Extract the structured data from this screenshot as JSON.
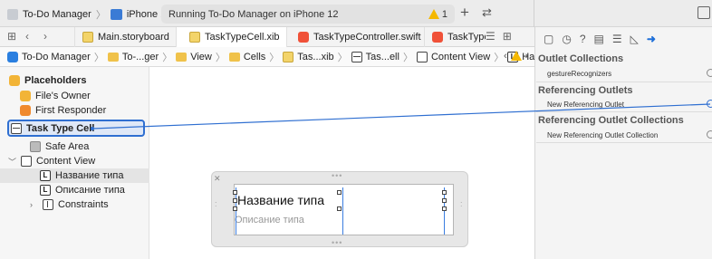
{
  "toolbar": {
    "scheme_project": "To-Do Manager",
    "scheme_device": "iPhone 12",
    "activity_text": "Running To-Do Manager on iPhone 12",
    "warning_count": "1",
    "plus": "+",
    "swap": "↩︎"
  },
  "tabs": [
    {
      "label": "Main.storyboard",
      "icon": "storyboard-icon"
    },
    {
      "label": "TaskTypeCell.xib",
      "icon": "xib-icon",
      "active": true
    },
    {
      "label": "TaskTypeController.swift",
      "icon": "swift-icon"
    },
    {
      "label": "TaskType",
      "icon": "swift-file-icon"
    }
  ],
  "jumpbar": {
    "items": [
      "To-Do Manager",
      "To-...ger",
      "View",
      "Cells",
      "Tas...xib",
      "Tas...ell",
      "Content View",
      "Название типа"
    ]
  },
  "outline": {
    "placeholders": "Placeholders",
    "files_owner": "File's Owner",
    "first_responder": "First Responder",
    "task_type_cell": "Task Type Cell",
    "safe_area": "Safe Area",
    "content_view": "Content View",
    "label_title": "Название типа",
    "label_desc": "Описание типа",
    "constraints": "Constraints"
  },
  "canvas": {
    "cell_title": "Название типа",
    "cell_subtitle": "Описание типа"
  },
  "inspector": {
    "outlet_collections": "Outlet Collections",
    "gesture_recognizers": "gestureRecognizers",
    "referencing_outlets": "Referencing Outlets",
    "new_referencing_outlet": "New Referencing Outlet",
    "referencing_outlet_collections": "Referencing Outlet Collections",
    "new_referencing_outlet_collection": "New Referencing Outlet Collection"
  },
  "colors": {
    "accent": "#2f6fd1",
    "warning": "#f5b800",
    "selection_fill": "#dfe8f7"
  }
}
